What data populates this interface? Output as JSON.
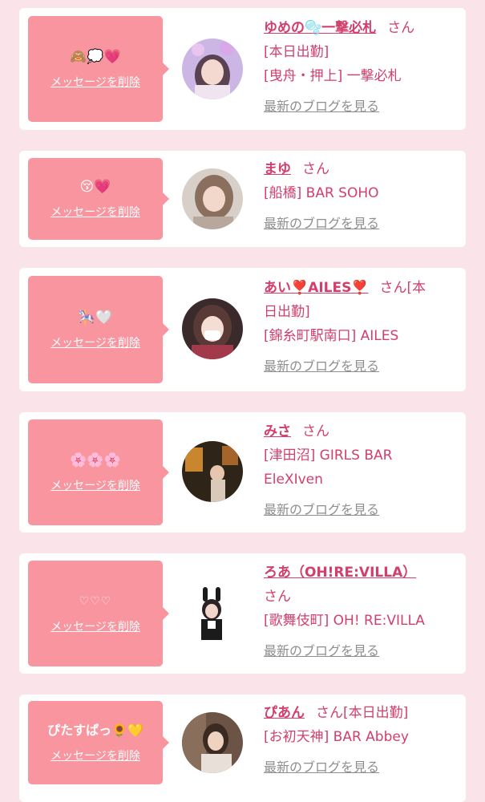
{
  "delete_label": "メッセージを削除",
  "blog_label": "最新のブログを見る",
  "san_suffix": "さん",
  "colors": {
    "accent": "#d23f6c",
    "bubble": "#f9959f",
    "background": "#fbe4e9",
    "link_gray": "#8e8e8e"
  },
  "messages": [
    {
      "message": "🙈💭💗",
      "name": "ゆめの🫧一撃必札",
      "lines": [
        "[本日出勤]",
        "[曳舟・押上] 一撃必札"
      ]
    },
    {
      "message": "😚💗",
      "name": "まゆ",
      "lines": [
        "[船橋] BAR SOHO"
      ]
    },
    {
      "message": "🎠🤍",
      "name": "あい❣️AILES❣️",
      "name_tail": "[本",
      "lines": [
        "日出勤]",
        "[錦糸町駅南口] AILES"
      ]
    },
    {
      "message": "🌸🌸🌸",
      "name": "みさ",
      "lines": [
        "[津田沼] GIRLS BAR",
        "EleXIven"
      ]
    },
    {
      "message": "♡♡♡",
      "name": "ろあ（OH!RE:VILLA）",
      "lines": [
        "[歌舞伎町] OH! RE:VILLA"
      ]
    },
    {
      "message": "ぴたすぱっ🌻💛",
      "name": "ぴあん",
      "name_tail": "[本日出勤]",
      "lines": [
        "[お初天神] BAR Abbey"
      ]
    }
  ]
}
